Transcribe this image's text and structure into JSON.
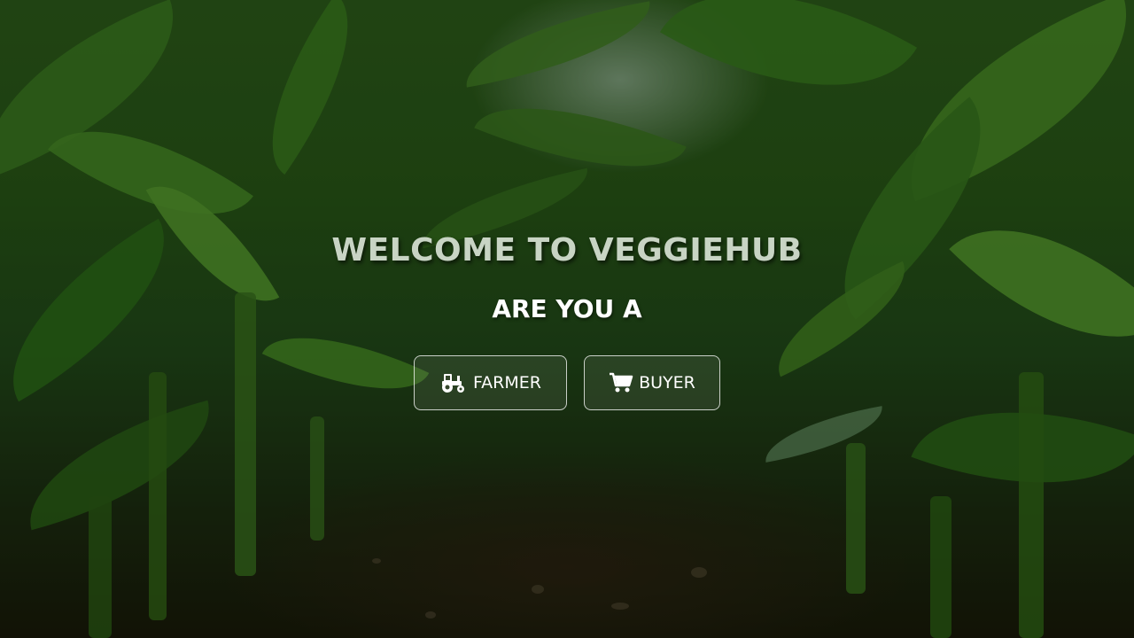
{
  "hero": {
    "title": "WELCOME TO VEGGIEHUB",
    "subtitle": "ARE YOU A"
  },
  "roles": {
    "farmer": {
      "label": "FARMER",
      "icon": "tractor-icon"
    },
    "buyer": {
      "label": "BUYER",
      "icon": "shopping-cart-icon"
    }
  },
  "colors": {
    "text_primary": "#ffffff",
    "title_text": "#c8d4c4",
    "button_border": "#ffffff",
    "foliage": "#2f5a1c",
    "soil": "#1a1409"
  }
}
